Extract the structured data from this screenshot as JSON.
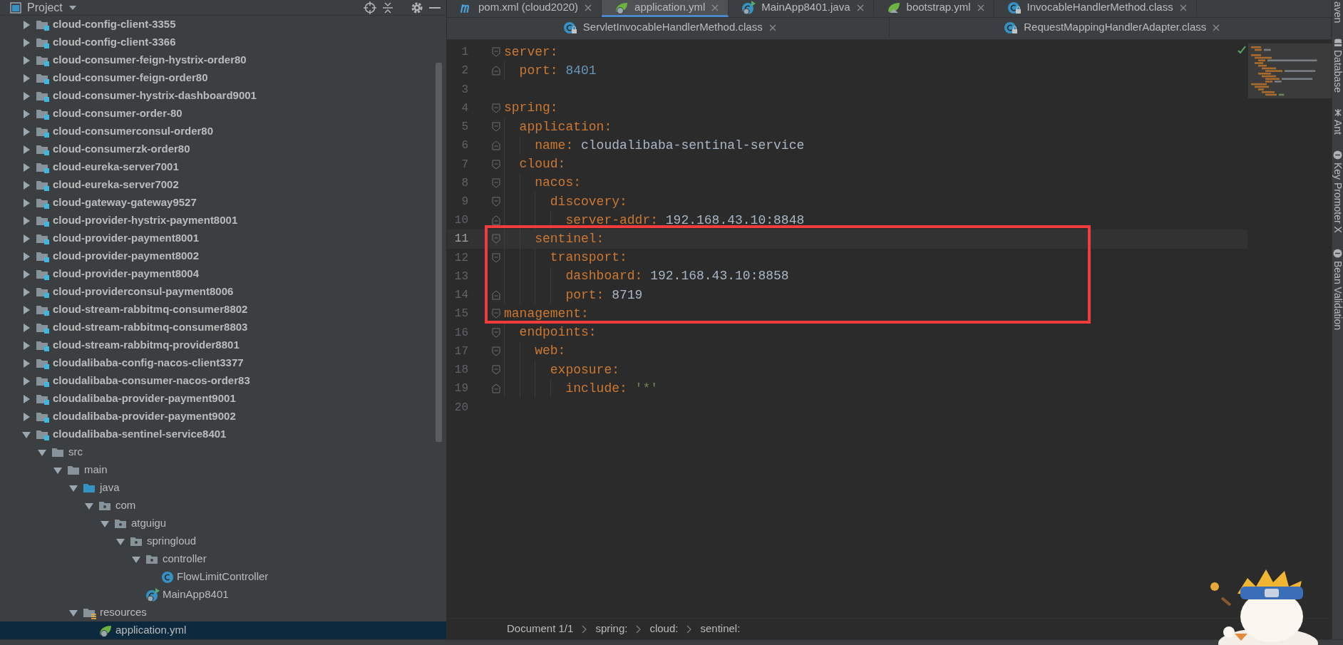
{
  "project_panel": {
    "title": "Project",
    "tree": [
      {
        "label": "cloud-config-client-3355",
        "kind": "module",
        "expanded": false,
        "selected": false
      },
      {
        "label": "cloud-config-client-3366",
        "kind": "module",
        "expanded": false,
        "selected": false
      },
      {
        "label": "cloud-consumer-feign-hystrix-order80",
        "kind": "module",
        "expanded": false,
        "selected": false
      },
      {
        "label": "cloud-consumer-feign-order80",
        "kind": "module",
        "expanded": false,
        "selected": false
      },
      {
        "label": "cloud-consumer-hystrix-dashboard9001",
        "kind": "module",
        "expanded": false,
        "selected": false
      },
      {
        "label": "cloud-consumer-order-80",
        "kind": "module",
        "expanded": false,
        "selected": false
      },
      {
        "label": "cloud-consumerconsul-order80",
        "kind": "module",
        "expanded": false,
        "selected": false
      },
      {
        "label": "cloud-consumerzk-order80",
        "kind": "module",
        "expanded": false,
        "selected": false
      },
      {
        "label": "cloud-eureka-server7001",
        "kind": "module",
        "expanded": false,
        "selected": false
      },
      {
        "label": "cloud-eureka-server7002",
        "kind": "module",
        "expanded": false,
        "selected": false
      },
      {
        "label": "cloud-gateway-gateway9527",
        "kind": "module",
        "expanded": false,
        "selected": false
      },
      {
        "label": "cloud-provider-hystrix-payment8001",
        "kind": "module",
        "expanded": false,
        "selected": false
      },
      {
        "label": "cloud-provider-payment8001",
        "kind": "module",
        "expanded": false,
        "selected": false
      },
      {
        "label": "cloud-provider-payment8002",
        "kind": "module",
        "expanded": false,
        "selected": false
      },
      {
        "label": "cloud-provider-payment8004",
        "kind": "module",
        "expanded": false,
        "selected": false
      },
      {
        "label": "cloud-providerconsul-payment8006",
        "kind": "module",
        "expanded": false,
        "selected": false
      },
      {
        "label": "cloud-stream-rabbitmq-consumer8802",
        "kind": "module",
        "expanded": false,
        "selected": false
      },
      {
        "label": "cloud-stream-rabbitmq-consumer8803",
        "kind": "module",
        "expanded": false,
        "selected": false
      },
      {
        "label": "cloud-stream-rabbitmq-provider8801",
        "kind": "module",
        "expanded": false,
        "selected": false
      },
      {
        "label": "cloudalibaba-config-nacos-client3377",
        "kind": "module",
        "expanded": false,
        "selected": false
      },
      {
        "label": "cloudalibaba-consumer-nacos-order83",
        "kind": "module",
        "expanded": false,
        "selected": false
      },
      {
        "label": "cloudalibaba-provider-payment9001",
        "kind": "module",
        "expanded": false,
        "selected": false
      },
      {
        "label": "cloudalibaba-provider-payment9002",
        "kind": "module",
        "expanded": false,
        "selected": false
      },
      {
        "label": "cloudalibaba-sentinel-service8401",
        "kind": "module",
        "expanded": true,
        "selected": false,
        "children": [
          {
            "label": "src",
            "kind": "folder",
            "expanded": true,
            "selected": false,
            "children": [
              {
                "label": "main",
                "kind": "folder",
                "expanded": true,
                "selected": false,
                "children": [
                  {
                    "label": "java",
                    "kind": "source-folder",
                    "expanded": true,
                    "selected": false,
                    "children": [
                      {
                        "label": "com",
                        "kind": "package",
                        "expanded": true,
                        "selected": false,
                        "children": [
                          {
                            "label": "atguigu",
                            "kind": "package",
                            "expanded": true,
                            "selected": false,
                            "children": [
                              {
                                "label": "springloud",
                                "kind": "package",
                                "expanded": true,
                                "selected": false,
                                "children": [
                                  {
                                    "label": "controller",
                                    "kind": "package",
                                    "expanded": true,
                                    "selected": false,
                                    "children": [
                                      {
                                        "label": "FlowLimitController",
                                        "kind": "class",
                                        "selected": false
                                      }
                                    ]
                                  },
                                  {
                                    "label": "MainApp8401",
                                    "kind": "spring-class",
                                    "selected": false
                                  }
                                ]
                              }
                            ]
                          }
                        ]
                      }
                    ]
                  },
                  {
                    "label": "resources",
                    "kind": "resources-folder",
                    "expanded": true,
                    "selected": false,
                    "children": [
                      {
                        "label": "application.yml",
                        "kind": "yaml",
                        "selected": true
                      }
                    ]
                  }
                ]
              }
            ]
          }
        ]
      }
    ]
  },
  "tab_rows": [
    {
      "tabs": [
        {
          "label": "pom.xml (cloud2020)",
          "kind": "maven",
          "selected": false
        },
        {
          "label": "application.yml",
          "kind": "yaml",
          "selected": true
        },
        {
          "label": "MainApp8401.java",
          "kind": "spring-class",
          "selected": false
        },
        {
          "label": "bootstrap.yml",
          "kind": "spring-yaml",
          "selected": false
        },
        {
          "label": "InvocableHandlerMethod.class",
          "kind": "class-locked",
          "selected": false
        }
      ]
    },
    {
      "tabs": [
        {
          "label": "ServletInvocableHandlerMethod.class",
          "kind": "class-locked",
          "selected": false
        },
        {
          "label": "RequestMappingHandlerAdapter.class",
          "kind": "class-locked",
          "selected": false
        }
      ]
    }
  ],
  "editor": {
    "lines": [
      {
        "number": "1",
        "key": "server:",
        "children": [
          {
            "number": "2",
            "key": "port:",
            "value": "8401",
            "kind": "number"
          }
        ]
      },
      {
        "number": "3"
      },
      {
        "number": "4",
        "key": "spring:",
        "children": [
          {
            "number": "5",
            "key": "application:",
            "children": [
              {
                "number": "6",
                "key": "name:",
                "value": "cloudalibaba-sentinal-service",
                "kind": "text"
              }
            ]
          },
          {
            "number": "7",
            "key": "cloud:",
            "children": [
              {
                "number": "8",
                "key": "nacos:",
                "children": [
                  {
                    "number": "9",
                    "key": "discovery:",
                    "children": [
                      {
                        "number": "10",
                        "key": "server-addr:",
                        "value": "192.168.43.10:8848",
                        "kind": "text"
                      }
                    ]
                  }
                ]
              },
              {
                "number": "11",
                "key": "sentinel:",
                "current": true,
                "highlighted": true,
                "children": [
                  {
                    "number": "12",
                    "key": "transport:",
                    "highlighted": true,
                    "children": [
                      {
                        "number": "13",
                        "key": "dashboard:",
                        "value": "192.168.43.10:8858",
                        "kind": "text",
                        "highlighted": true
                      },
                      {
                        "number": "14",
                        "key": "port:",
                        "value": "8719",
                        "kind": "text",
                        "highlighted": true
                      }
                    ]
                  }
                ]
              }
            ]
          }
        ]
      },
      {
        "number": "15",
        "key": "management:",
        "highlighted": true,
        "children": [
          {
            "number": "16",
            "key": "endpoints:",
            "children": [
              {
                "number": "17",
                "key": "web:",
                "children": [
                  {
                    "number": "18",
                    "key": "exposure:",
                    "children": [
                      {
                        "number": "19",
                        "key": "include:",
                        "value": "'*'",
                        "kind": "string"
                      }
                    ]
                  }
                ]
              }
            ]
          }
        ]
      },
      {
        "number": "20"
      }
    ]
  },
  "breadcrumb": [
    "Document 1/1",
    "spring:",
    "cloud:",
    "sentinel:"
  ],
  "side_tools": [
    {
      "label": "aven",
      "kind": "none"
    },
    {
      "label": "Database",
      "kind": "database"
    },
    {
      "label": "Ant",
      "kind": "ant"
    },
    {
      "label": "Key Promoter X",
      "kind": "circle"
    },
    {
      "label": "Bean Validation",
      "kind": "circle"
    }
  ]
}
